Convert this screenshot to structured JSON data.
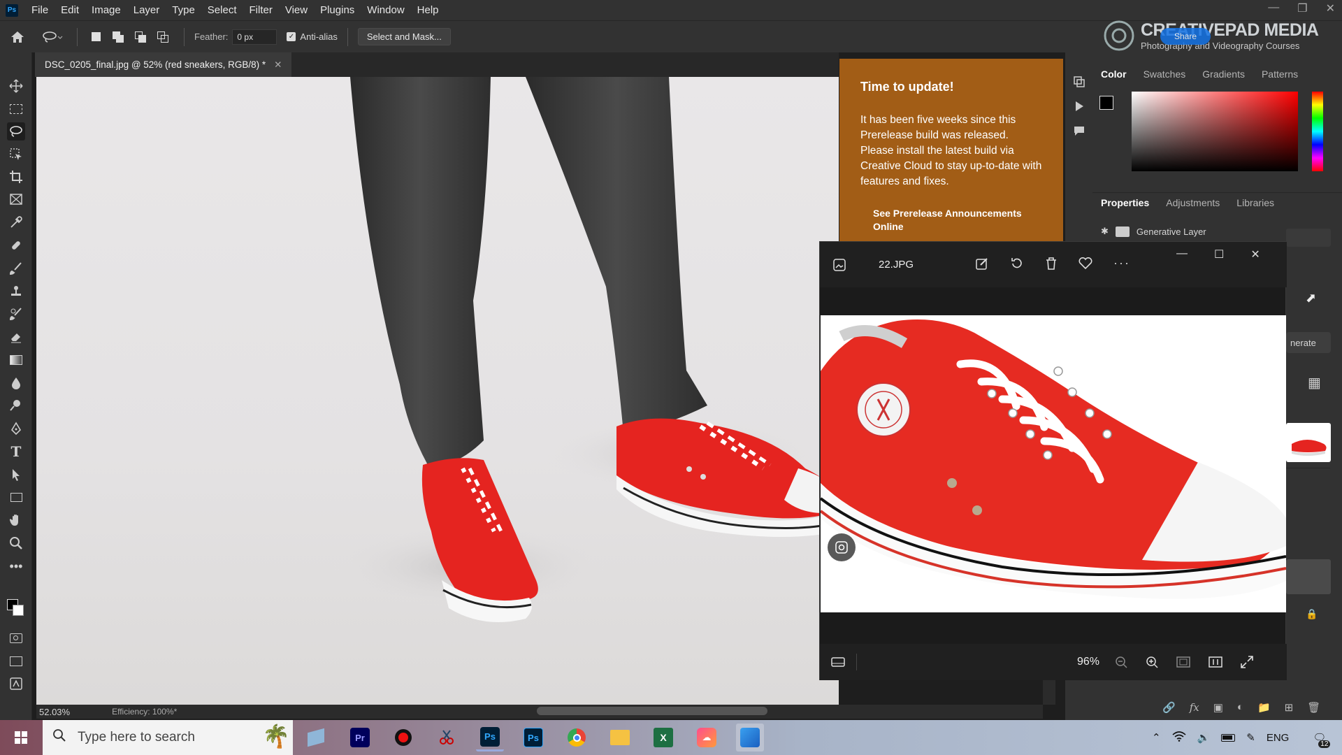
{
  "menubar": {
    "logo": "Ps",
    "items": [
      "File",
      "Edit",
      "Image",
      "Layer",
      "Type",
      "Select",
      "Filter",
      "View",
      "Plugins",
      "Window",
      "Help"
    ]
  },
  "options": {
    "feather_label": "Feather:",
    "feather_value": "0 px",
    "antialias_label": "Anti-alias",
    "select_mask_label": "Select and Mask..."
  },
  "watermark": {
    "title": "CREATIVEPAD MEDIA",
    "subtitle": "Photography and Videography Courses",
    "share": "Share"
  },
  "document": {
    "tab_title": "DSC_0205_final.jpg @ 52% (red sneakers, RGB/8) *"
  },
  "status": {
    "zoom": "52.03%",
    "efficiency": "Efficiency: 100%*"
  },
  "update_popup": {
    "title": "Time to update!",
    "body": "It has been five weeks since this Prerelease build was released. Please install the latest build via Creative Cloud to stay up-to-date with features and fixes.",
    "link": "See Prerelease Announcements Online"
  },
  "color_panel": {
    "tabs": [
      "Color",
      "Swatches",
      "Gradients",
      "Patterns"
    ]
  },
  "properties_panel": {
    "tabs": [
      "Properties",
      "Adjustments",
      "Libraries"
    ],
    "layer_type": "Generative Layer",
    "generate_btn": "nerate"
  },
  "photos": {
    "filename": "22.JPG",
    "zoom": "96%"
  },
  "taskbar": {
    "search_placeholder": "Type here to search",
    "lang": "ENG",
    "notif_count": "12"
  },
  "colors": {
    "accent": "#31a8ff",
    "update_bg": "#a25d16",
    "sneaker_red": "#e8231f"
  }
}
